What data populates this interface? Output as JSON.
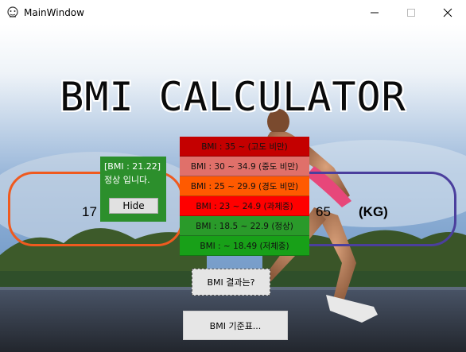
{
  "window": {
    "title": "MainWindow",
    "icon": "app-icon",
    "controls": {
      "minimize": "─",
      "maximize": "☐",
      "close": "✕"
    }
  },
  "heading": "BMI CALCULATOR",
  "inputs": {
    "height_value": "17",
    "weight_value": "65",
    "weight_unit": "(KG)"
  },
  "result_panel": {
    "line1": "[BMI : 21.22]",
    "line2": "정상 입니다.",
    "hide_button": "Hide",
    "color": "#2c8f2c"
  },
  "bmi_scale": [
    {
      "label": "BMI : 35 ~ (고도 비만)",
      "color": "#c40000"
    },
    {
      "label": "BMI : 30 ~ 34.9 (중도 비만)",
      "color": "#e0706a"
    },
    {
      "label": "BMI : 25 ~ 29.9 (경도 비만)",
      "color": "#ff5a00"
    },
    {
      "label": "BMI : 23 ~ 24.9 (과체중)",
      "color": "#ff0000"
    },
    {
      "label": "BMI : 18.5 ~ 22.9 (정상)",
      "color": "#2a9a2a"
    },
    {
      "label": "BMI : ~ 18.49 (저체중)",
      "color": "#18a018"
    }
  ],
  "buttons": {
    "check_result": "BMI 결과는?",
    "criteria_table": "BMI 기준표..."
  },
  "colors": {
    "height_ring": "#ef5a1f",
    "weight_ring": "#4b3f9d"
  }
}
